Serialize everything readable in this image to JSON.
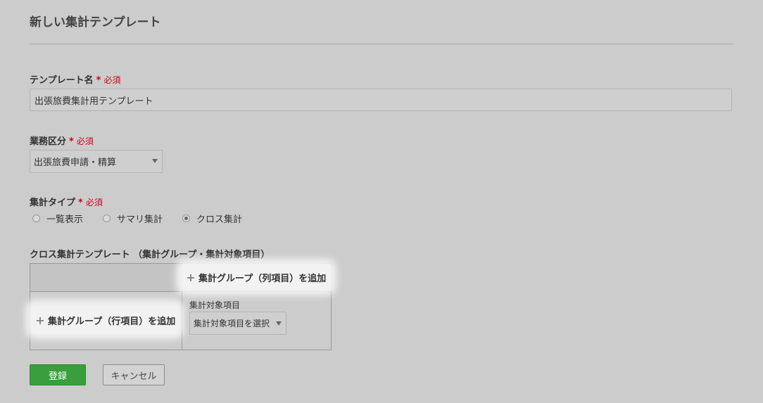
{
  "page": {
    "title": "新しい集計テンプレート"
  },
  "form": {
    "template_name": {
      "label": "テンプレート名",
      "required_star": "*",
      "required_text": "必須",
      "value": "出張旅費集計用テンプレート"
    },
    "business_category": {
      "label": "業務区分",
      "required_star": "*",
      "required_text": "必須",
      "selected": "出張旅費申請・精算"
    },
    "aggregation_type": {
      "label": "集計タイプ",
      "required_star": "*",
      "required_text": "必須",
      "options": [
        {
          "label": "一覧表示",
          "checked": false
        },
        {
          "label": "サマリ集計",
          "checked": false
        },
        {
          "label": "クロス集計",
          "checked": true
        }
      ]
    },
    "cross_template": {
      "label": "クロス集計テンプレート （集計グループ・集計対象項目）",
      "add_column_group": "集計グループ（列項目）を追加",
      "add_row_group": "集計グループ（行項目）を追加",
      "target_item_label": "集計対象項目",
      "target_item_select": "集計対象項目を選択"
    }
  },
  "buttons": {
    "submit": "登録",
    "cancel": "キャンセル"
  },
  "colors": {
    "required": "#d0021b",
    "primary_button": "#3a9e3c",
    "background": "#cccccc"
  },
  "icons": {
    "add": "plus-icon",
    "select_caret": "caret-down-icon"
  }
}
